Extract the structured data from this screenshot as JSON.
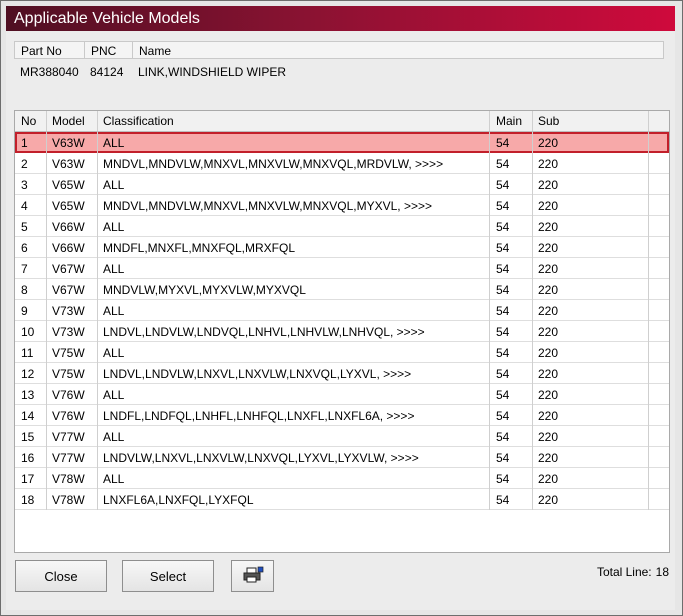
{
  "window": {
    "title": "Applicable Vehicle Models"
  },
  "part": {
    "headers": {
      "part_no": "Part No",
      "pnc": "PNC",
      "name": "Name"
    },
    "values": {
      "part_no": "MR388040",
      "pnc": "84124",
      "name": "LINK,WINDSHIELD WIPER"
    }
  },
  "table": {
    "headers": {
      "no": "No",
      "model": "Model",
      "classification": "Classification",
      "main": "Main",
      "sub": "Sub"
    },
    "rows": [
      {
        "no": "1",
        "model": "V63W",
        "classification": "ALL",
        "main": "54",
        "sub": "220",
        "selected": true
      },
      {
        "no": "2",
        "model": "V63W",
        "classification": "MNDVL,MNDVLW,MNXVL,MNXVLW,MNXVQL,MRDVLW,  >>>>",
        "main": "54",
        "sub": "220"
      },
      {
        "no": "3",
        "model": "V65W",
        "classification": "ALL",
        "main": "54",
        "sub": "220"
      },
      {
        "no": "4",
        "model": "V65W",
        "classification": "MNDVL,MNDVLW,MNXVL,MNXVLW,MNXVQL,MYXVL,  >>>>",
        "main": "54",
        "sub": "220"
      },
      {
        "no": "5",
        "model": "V66W",
        "classification": "ALL",
        "main": "54",
        "sub": "220"
      },
      {
        "no": "6",
        "model": "V66W",
        "classification": "MNDFL,MNXFL,MNXFQL,MRXFQL",
        "main": "54",
        "sub": "220"
      },
      {
        "no": "7",
        "model": "V67W",
        "classification": "ALL",
        "main": "54",
        "sub": "220"
      },
      {
        "no": "8",
        "model": "V67W",
        "classification": "MNDVLW,MYXVL,MYXVLW,MYXVQL",
        "main": "54",
        "sub": "220"
      },
      {
        "no": "9",
        "model": "V73W",
        "classification": "ALL",
        "main": "54",
        "sub": "220"
      },
      {
        "no": "10",
        "model": "V73W",
        "classification": "LNDVL,LNDVLW,LNDVQL,LNHVL,LNHVLW,LNHVQL,  >>>>",
        "main": "54",
        "sub": "220"
      },
      {
        "no": "11",
        "model": "V75W",
        "classification": "ALL",
        "main": "54",
        "sub": "220"
      },
      {
        "no": "12",
        "model": "V75W",
        "classification": "LNDVL,LNDVLW,LNXVL,LNXVLW,LNXVQL,LYXVL,  >>>>",
        "main": "54",
        "sub": "220"
      },
      {
        "no": "13",
        "model": "V76W",
        "classification": "ALL",
        "main": "54",
        "sub": "220"
      },
      {
        "no": "14",
        "model": "V76W",
        "classification": "LNDFL,LNDFQL,LNHFL,LNHFQL,LNXFL,LNXFL6A,  >>>>",
        "main": "54",
        "sub": "220"
      },
      {
        "no": "15",
        "model": "V77W",
        "classification": "ALL",
        "main": "54",
        "sub": "220"
      },
      {
        "no": "16",
        "model": "V77W",
        "classification": "LNDVLW,LNXVL,LNXVLW,LNXVQL,LYXVL,LYXVLW,  >>>>",
        "main": "54",
        "sub": "220"
      },
      {
        "no": "17",
        "model": "V78W",
        "classification": "ALL",
        "main": "54",
        "sub": "220"
      },
      {
        "no": "18",
        "model": "V78W",
        "classification": "LNXFL6A,LNXFQL,LYXFQL",
        "main": "54",
        "sub": "220"
      }
    ]
  },
  "footer": {
    "close_label": "Close",
    "select_label": "Select",
    "print_icon": "printer-icon",
    "total_label": "Total Line:",
    "total_value": "18"
  },
  "colors": {
    "title_start": "#4f0f22",
    "title_end": "#cf0a3c",
    "selected_row": "#f7a9a9",
    "selected_border": "#c21f2a"
  }
}
